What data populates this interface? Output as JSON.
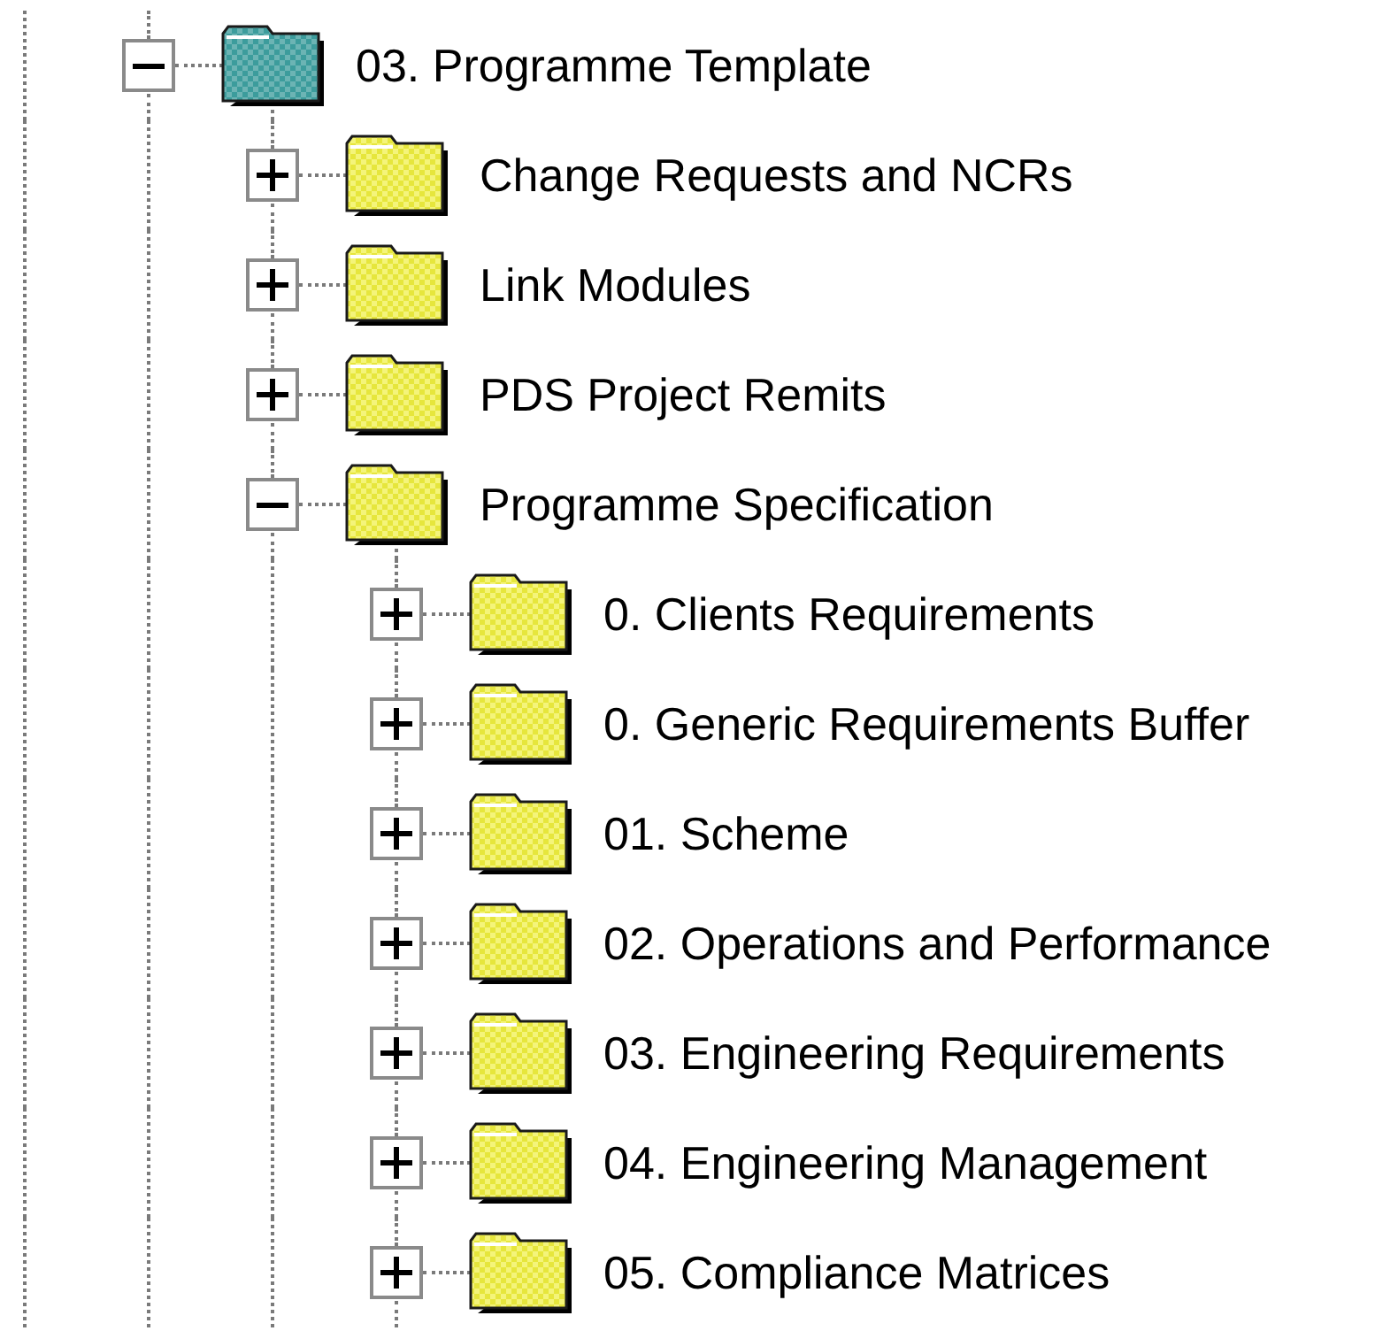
{
  "tree": {
    "items": [
      {
        "label": "03. Programme Template",
        "expanded": true,
        "selected": true,
        "children": [
          {
            "label": "Change Requests and NCRs",
            "expanded": false,
            "selected": false
          },
          {
            "label": "Link Modules",
            "expanded": false,
            "selected": false
          },
          {
            "label": "PDS Project Remits",
            "expanded": false,
            "selected": false
          },
          {
            "label": "Programme Specification",
            "expanded": true,
            "selected": false,
            "children": [
              {
                "label": "0. Clients Requirements",
                "expanded": false,
                "selected": false
              },
              {
                "label": "0. Generic Requirements Buffer",
                "expanded": false,
                "selected": false
              },
              {
                "label": "01. Scheme",
                "expanded": false,
                "selected": false
              },
              {
                "label": "02. Operations and Performance",
                "expanded": false,
                "selected": false
              },
              {
                "label": "03. Engineering Requirements",
                "expanded": false,
                "selected": false
              },
              {
                "label": "04. Engineering Management",
                "expanded": false,
                "selected": false
              },
              {
                "label": "05. Compliance Matrices",
                "expanded": false,
                "selected": false
              }
            ]
          }
        ]
      }
    ]
  }
}
